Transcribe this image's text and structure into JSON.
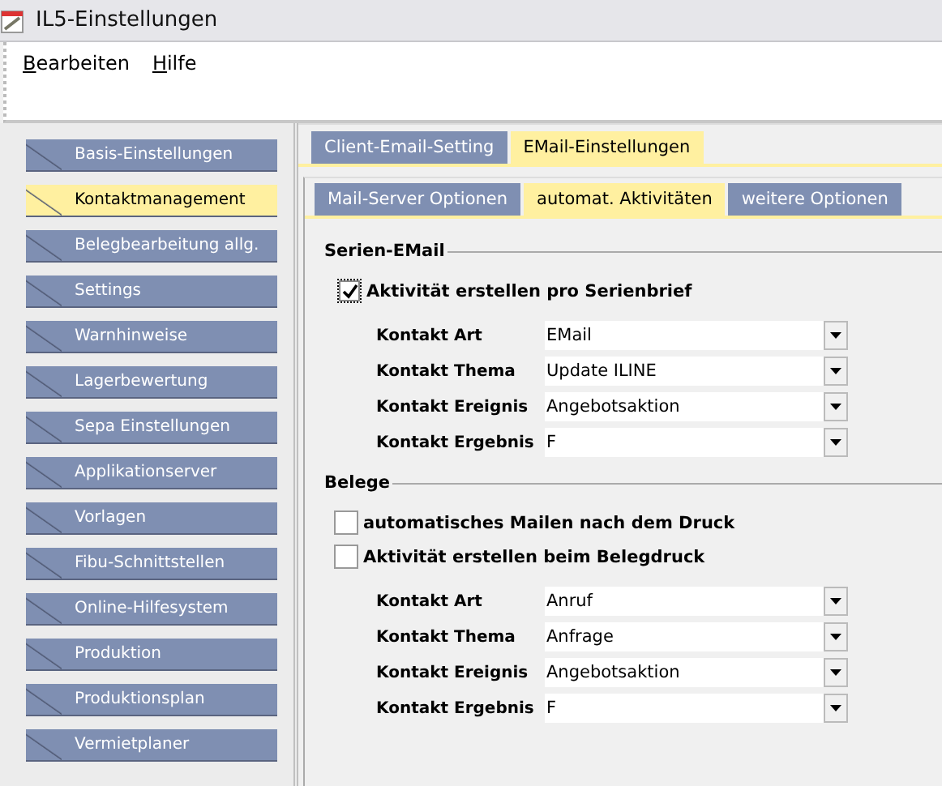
{
  "window": {
    "title": "IL5-Einstellungen"
  },
  "menu": [
    {
      "label": "Bearbeiten"
    },
    {
      "label": "Hilfe"
    }
  ],
  "sidebar": {
    "items": [
      {
        "label": "Basis-Einstellungen",
        "selected": false
      },
      {
        "label": "Kontaktmanagement",
        "selected": true
      },
      {
        "label": "Belegbearbeitung allg.",
        "selected": false
      },
      {
        "label": "Settings",
        "selected": false
      },
      {
        "label": "Warnhinweise",
        "selected": false
      },
      {
        "label": "Lagerbewertung",
        "selected": false
      },
      {
        "label": "Sepa Einstellungen",
        "selected": false
      },
      {
        "label": "Applikationserver",
        "selected": false
      },
      {
        "label": "Vorlagen",
        "selected": false
      },
      {
        "label": "Fibu-Schnittstellen",
        "selected": false
      },
      {
        "label": "Online-Hilfesystem",
        "selected": false
      },
      {
        "label": "Produktion",
        "selected": false
      },
      {
        "label": "Produktionsplan",
        "selected": false
      },
      {
        "label": "Vermietplaner",
        "selected": false
      }
    ]
  },
  "tabs": [
    {
      "label": "Client-Email-Setting",
      "selected": false
    },
    {
      "label": "EMail-Einstellungen",
      "selected": true
    }
  ],
  "subtabs": [
    {
      "label": "Mail-Server Optionen",
      "selected": false
    },
    {
      "label": "automat. Aktivitäten",
      "selected": true
    },
    {
      "label": "weitere Optionen",
      "selected": false
    }
  ],
  "sections": [
    {
      "title": "Serien-EMail",
      "checkboxes": [
        {
          "label": "Aktivität erstellen pro Serienbrief",
          "checked": true,
          "focused": true
        }
      ],
      "fields": [
        {
          "label": "Kontakt Art",
          "value": "EMail"
        },
        {
          "label": "Kontakt Thema",
          "value": "Update ILINE"
        },
        {
          "label": "Kontakt Ereignis",
          "value": "Angebotsaktion"
        },
        {
          "label": "Kontakt Ergebnis",
          "value": "F"
        }
      ]
    },
    {
      "title": "Belege",
      "checkboxes": [
        {
          "label": "automatisches Mailen nach dem Druck",
          "checked": false,
          "focused": false
        },
        {
          "label": "Aktivität erstellen beim Belegdruck",
          "checked": false,
          "focused": false
        }
      ],
      "fields": [
        {
          "label": "Kontakt Art",
          "value": "Anruf"
        },
        {
          "label": "Kontakt Thema",
          "value": "Anfrage"
        },
        {
          "label": "Kontakt Ereignis",
          "value": "Angebotsaktion"
        },
        {
          "label": "Kontakt Ergebnis",
          "value": "F"
        }
      ]
    }
  ]
}
